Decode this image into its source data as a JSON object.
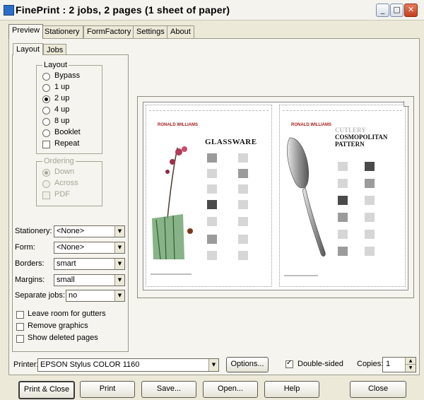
{
  "window": {
    "title": "FinePrint : 2 jobs, 2 pages (1 sheet of paper)",
    "minimize_glyph": "_",
    "maximize_glyph": "□",
    "close_glyph": "✕"
  },
  "tabs": [
    "Preview",
    "Stationery",
    "FormFactory",
    "Settings",
    "About"
  ],
  "active_tab": "Preview",
  "subtabs": [
    "Layout",
    "Jobs"
  ],
  "active_subtab": "Layout",
  "layout": {
    "group_title": "Layout",
    "options": [
      "Bypass",
      "1 up",
      "2 up",
      "4 up",
      "8 up",
      "Booklet"
    ],
    "selected": "2 up",
    "repeat_label": "Repeat",
    "repeat_checked": false
  },
  "ordering": {
    "group_title": "Ordering",
    "options": [
      "Down",
      "Across"
    ],
    "selected": "Down",
    "pdf_label": "PDF",
    "enabled": false
  },
  "fields": {
    "stationery_label": "Stationery:",
    "stationery_value": "<None>",
    "form_label": "Form:",
    "form_value": "<None>",
    "borders_label": "Borders:",
    "borders_value": "smart",
    "margins_label": "Margins:",
    "margins_value": "small",
    "separate_label": "Separate jobs:",
    "separate_value": "no"
  },
  "checks": {
    "gutters": "Leave room for gutters",
    "remove_graphics": "Remove graphics",
    "show_deleted": "Show deleted pages"
  },
  "preview": {
    "left_heading": "GLASSWARE",
    "right_heading_1": "CUTLERY",
    "right_heading_2": "COSMOPOLITAN",
    "right_heading_3": "PATTERN",
    "logo_text": "RONALD WILLIAMS"
  },
  "printer": {
    "label": "Printer:",
    "value": "EPSON Stylus COLOR 1160",
    "options_button": "Options...",
    "double_sided_label": "Double-sided",
    "double_sided_checked": true,
    "copies_label": "Copies:",
    "copies_value": "1"
  },
  "buttons": {
    "print_close": "Print & Close",
    "print": "Print",
    "save": "Save...",
    "open": "Open...",
    "help": "Help",
    "close": "Close"
  }
}
